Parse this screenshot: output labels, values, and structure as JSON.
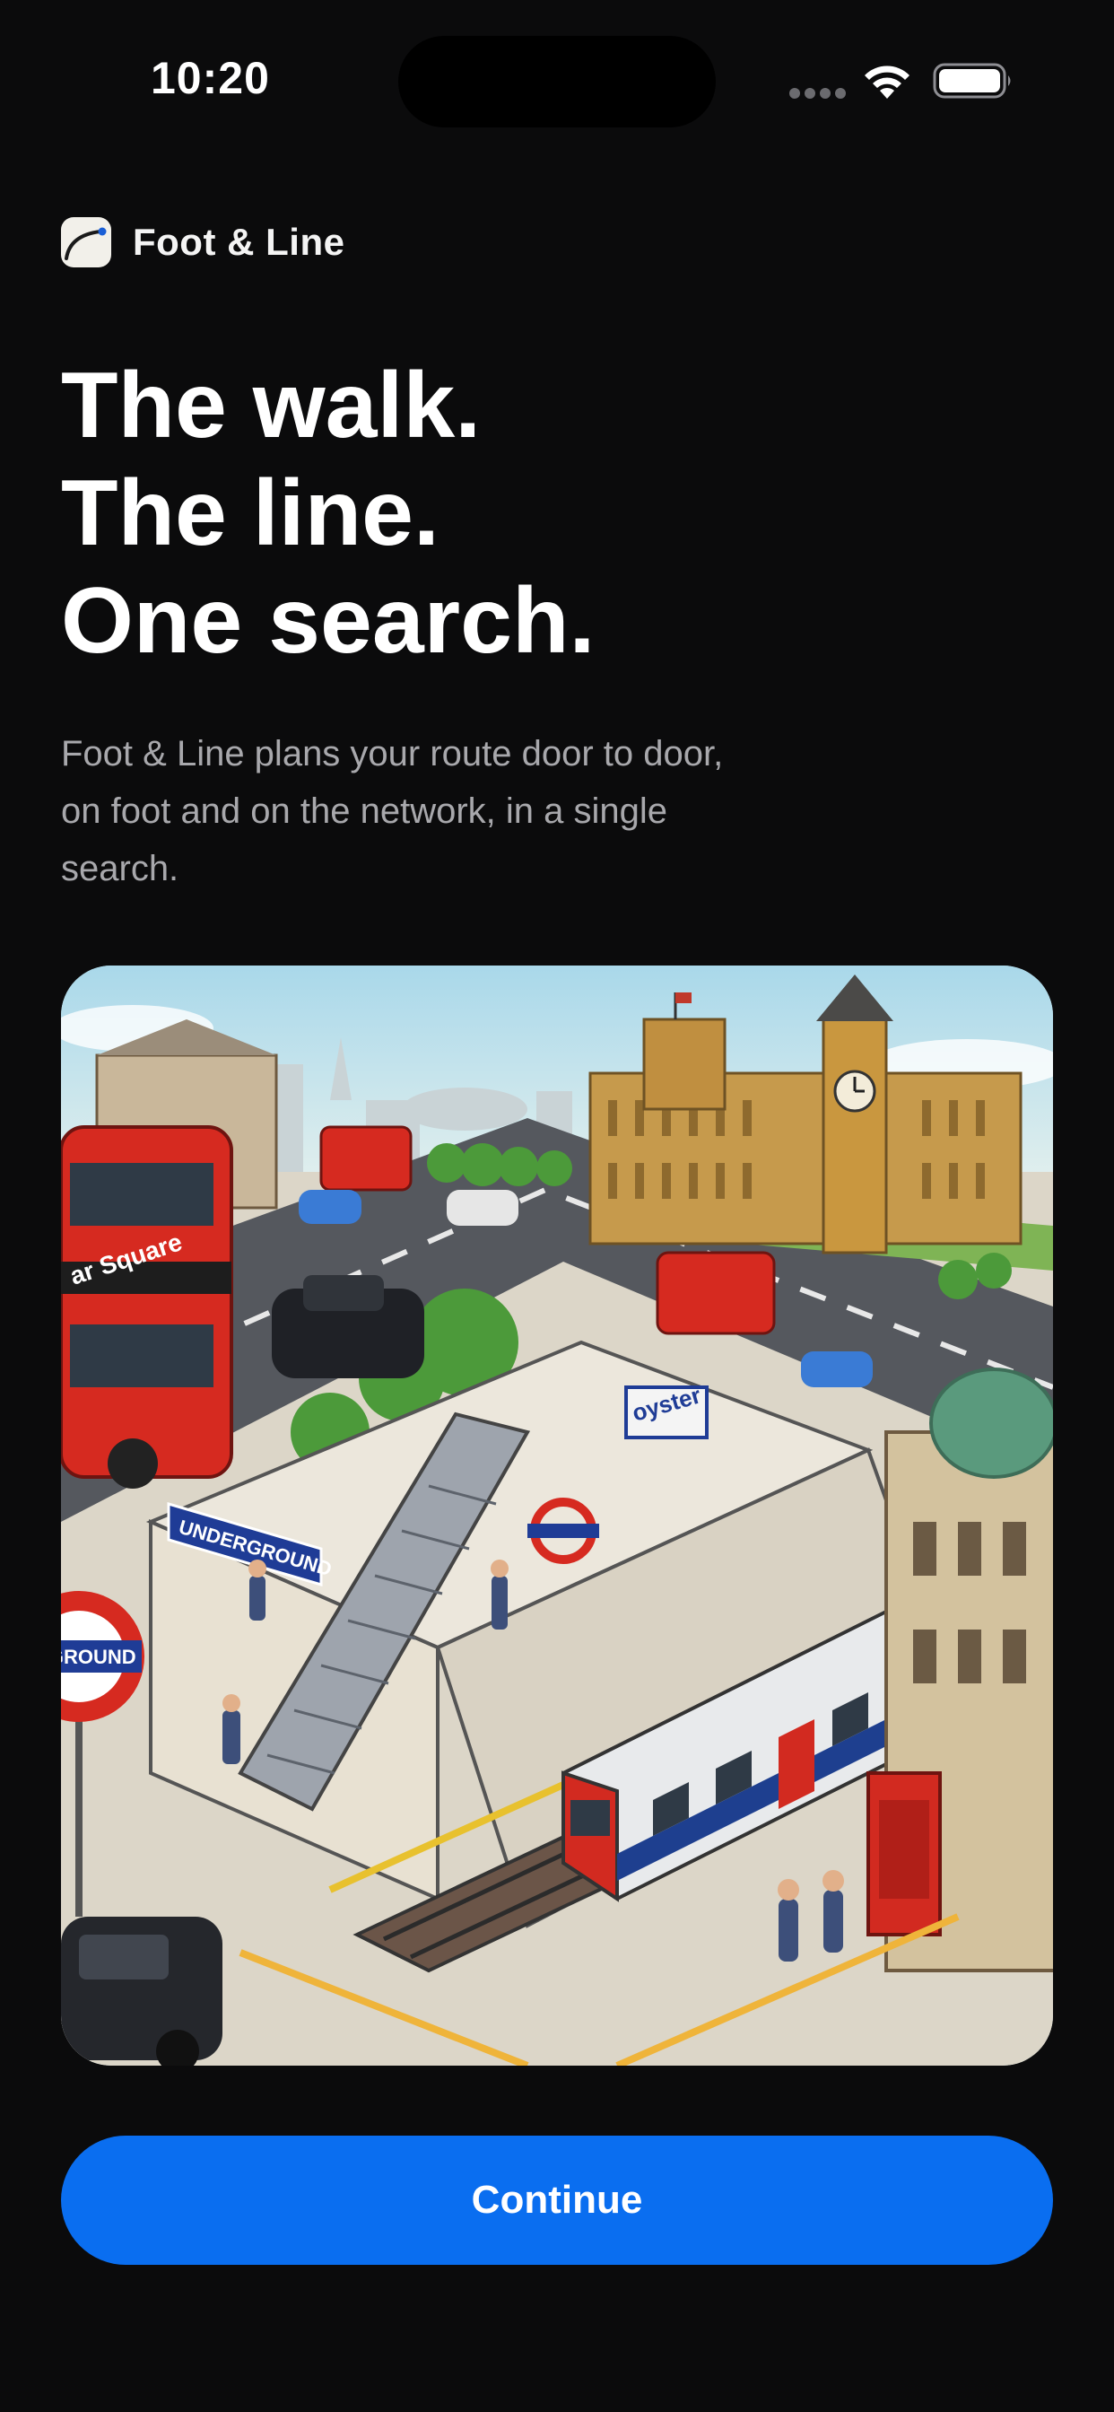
{
  "status_bar": {
    "time": "10:20",
    "icons": [
      "cellular-signal-icon",
      "wifi-icon",
      "battery-icon"
    ]
  },
  "brand": {
    "logo_icon": "route-line-logo-icon",
    "name": "Foot & Line"
  },
  "headline": {
    "lines": [
      "The walk.",
      "The line.",
      "One search."
    ]
  },
  "subtitle": "Foot & Line plans your route door to door, on foot and on the network, in a single search.",
  "hero_illustration": {
    "signs": {
      "bus_destination": "ar Square",
      "underground_banner": "UNDERGROUND",
      "roundel_text": "RGROUND",
      "oyster_sign": "oyster"
    }
  },
  "continue_button": {
    "label": "Continue"
  },
  "colors": {
    "background": "#0b0b0c",
    "accent": "#0a6ef0",
    "text_primary": "#ffffff",
    "text_secondary": "#a8a8ac"
  }
}
